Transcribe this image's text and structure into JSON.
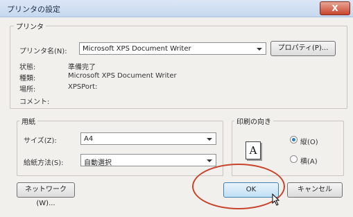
{
  "window": {
    "title": "プリンタの設定",
    "close_label": "X",
    "accent_close": "#c9452e"
  },
  "printer_group": {
    "title": "プリンタ",
    "name_label": "プリンタ名(N):",
    "name_value": "Microsoft XPS Document Writer",
    "properties_button": "プロパティ(P)...",
    "status_label": "状態:",
    "status_value": "準備完了",
    "type_label": "種類:",
    "type_value": "Microsoft XPS Document Writer",
    "where_label": "場所:",
    "where_value": "XPSPort:",
    "comment_label": "コメント:",
    "comment_value": ""
  },
  "paper_group": {
    "title": "用紙",
    "size_label": "サイズ(Z):",
    "size_value": "A4",
    "source_label": "給紙方法(S):",
    "source_value": "自動選択"
  },
  "orientation_group": {
    "title": "印刷の向き",
    "page_glyph": "A",
    "portrait_label": "縦(O)",
    "landscape_label": "横(A)",
    "selected": "portrait"
  },
  "buttons": {
    "network": "ネットワーク(W)...",
    "ok": "OK",
    "cancel": "キャンセル"
  },
  "annotation": {
    "highlight_color": "#c8442c"
  }
}
